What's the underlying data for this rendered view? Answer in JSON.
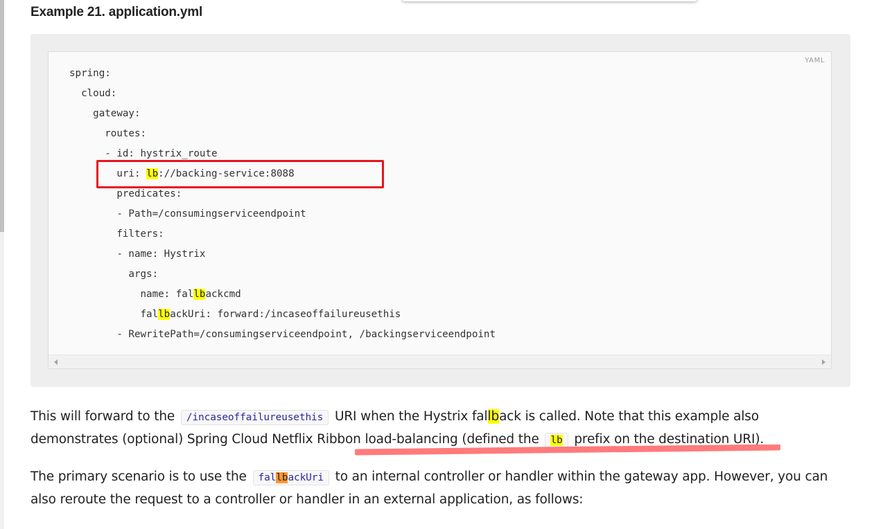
{
  "example": {
    "title": "Example 21. application.yml",
    "language": "YAML",
    "lines": [
      {
        "indent": 0,
        "parts": [
          {
            "t": "spring:"
          }
        ]
      },
      {
        "indent": 2,
        "parts": [
          {
            "t": "cloud:"
          }
        ]
      },
      {
        "indent": 4,
        "parts": [
          {
            "t": "gateway:"
          }
        ]
      },
      {
        "indent": 6,
        "parts": [
          {
            "t": "routes:"
          }
        ]
      },
      {
        "indent": 6,
        "parts": [
          {
            "t": "- id: hystrix_route"
          }
        ]
      },
      {
        "indent": 8,
        "parts": [
          {
            "t": "uri: "
          },
          {
            "t": "lb",
            "hl": true
          },
          {
            "t": "://backing-service:8088"
          }
        ]
      },
      {
        "indent": 8,
        "parts": [
          {
            "t": "predicates:"
          }
        ]
      },
      {
        "indent": 8,
        "parts": [
          {
            "t": "- Path=/consumingserviceendpoint"
          }
        ]
      },
      {
        "indent": 8,
        "parts": [
          {
            "t": "filters:"
          }
        ]
      },
      {
        "indent": 8,
        "parts": [
          {
            "t": "- name: Hystrix"
          }
        ]
      },
      {
        "indent": 10,
        "parts": [
          {
            "t": "args:"
          }
        ]
      },
      {
        "indent": 12,
        "parts": [
          {
            "t": "name: fal"
          },
          {
            "t": "lb",
            "hl": true
          },
          {
            "t": "ackcmd"
          }
        ]
      },
      {
        "indent": 12,
        "parts": [
          {
            "t": "fal"
          },
          {
            "t": "lb",
            "hl": true
          },
          {
            "t": "ackUri: forward:/incaseoffailureusethis"
          }
        ]
      },
      {
        "indent": 8,
        "parts": [
          {
            "t": "- RewritePath=/consumingserviceendpoint, /backingserviceendpoint"
          }
        ]
      }
    ]
  },
  "paragraph1": {
    "text_a": "This will forward to the",
    "code_a": "/incaseoffailureusethis",
    "text_b": "URI when the Hystrix fal",
    "hl_b": "lb",
    "text_c": "ack is called. Note that this example also demonstrates (optional) Spring Cloud Netflix Ribbon load-balancing (defined the",
    "code_b": "lb",
    "text_d": "prefix on the destination URI)."
  },
  "paragraph2": {
    "text_a": "The primary scenario is to use the",
    "code_pre": "fal",
    "code_hl": "lb",
    "code_post": "ackUri",
    "text_b": "to an internal controller or handler within the gateway app. However, you can also reroute the request to a controller or handler in an external application, as follows:"
  },
  "colors": {
    "highlight": "#ffff00",
    "current_match": "#ff9632",
    "annotation_box": "#e8141e",
    "annotation_underline": "#ff7b7b"
  }
}
